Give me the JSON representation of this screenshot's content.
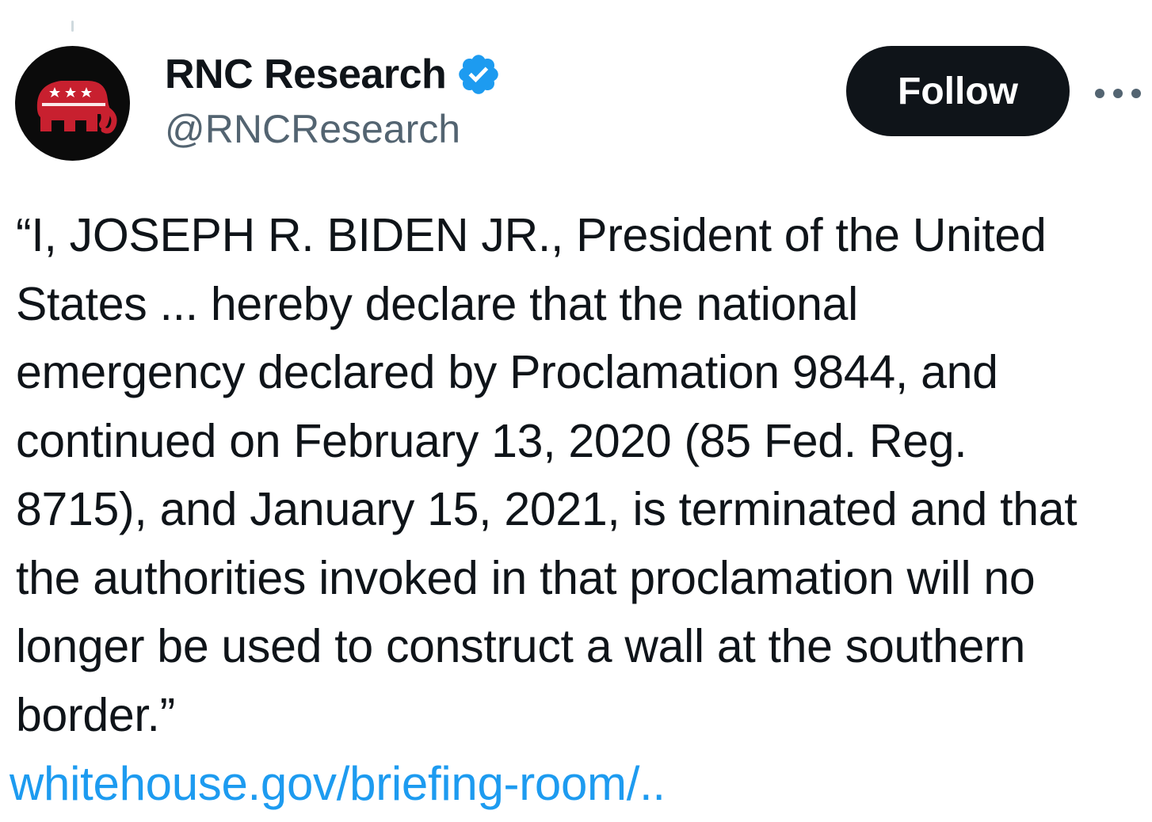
{
  "author": {
    "display_name": "RNC Research",
    "handle": "@RNCResearch",
    "verified": true,
    "avatar_icon": "gop-elephant-icon",
    "verified_icon": "verified-badge-icon"
  },
  "actions": {
    "follow_label": "Follow",
    "more_icon": "more-dots-icon"
  },
  "tweet": {
    "text": "“I, JOSEPH R. BIDEN JR., President of the United\nStates ... hereby declare that the national\nemergency declared by Proclamation 9844, and\ncontinued on February 13, 2020 (85 Fed. Reg.\n8715), and January 15, 2021, is terminated and that\nthe authorities invoked in that proclamation will no\nlonger be used to construct a wall at the southern\nborder.”",
    "link_text": "whitehouse.gov/briefing-room/.."
  },
  "colors": {
    "text": "#0f1419",
    "secondary_text": "#536471",
    "link": "#1d9bf0",
    "verified": "#1d9bf0",
    "follow_bg": "#0f1419",
    "follow_text": "#ffffff",
    "avatar_bg": "#0b0b0b",
    "elephant_red": "#c8202f"
  }
}
